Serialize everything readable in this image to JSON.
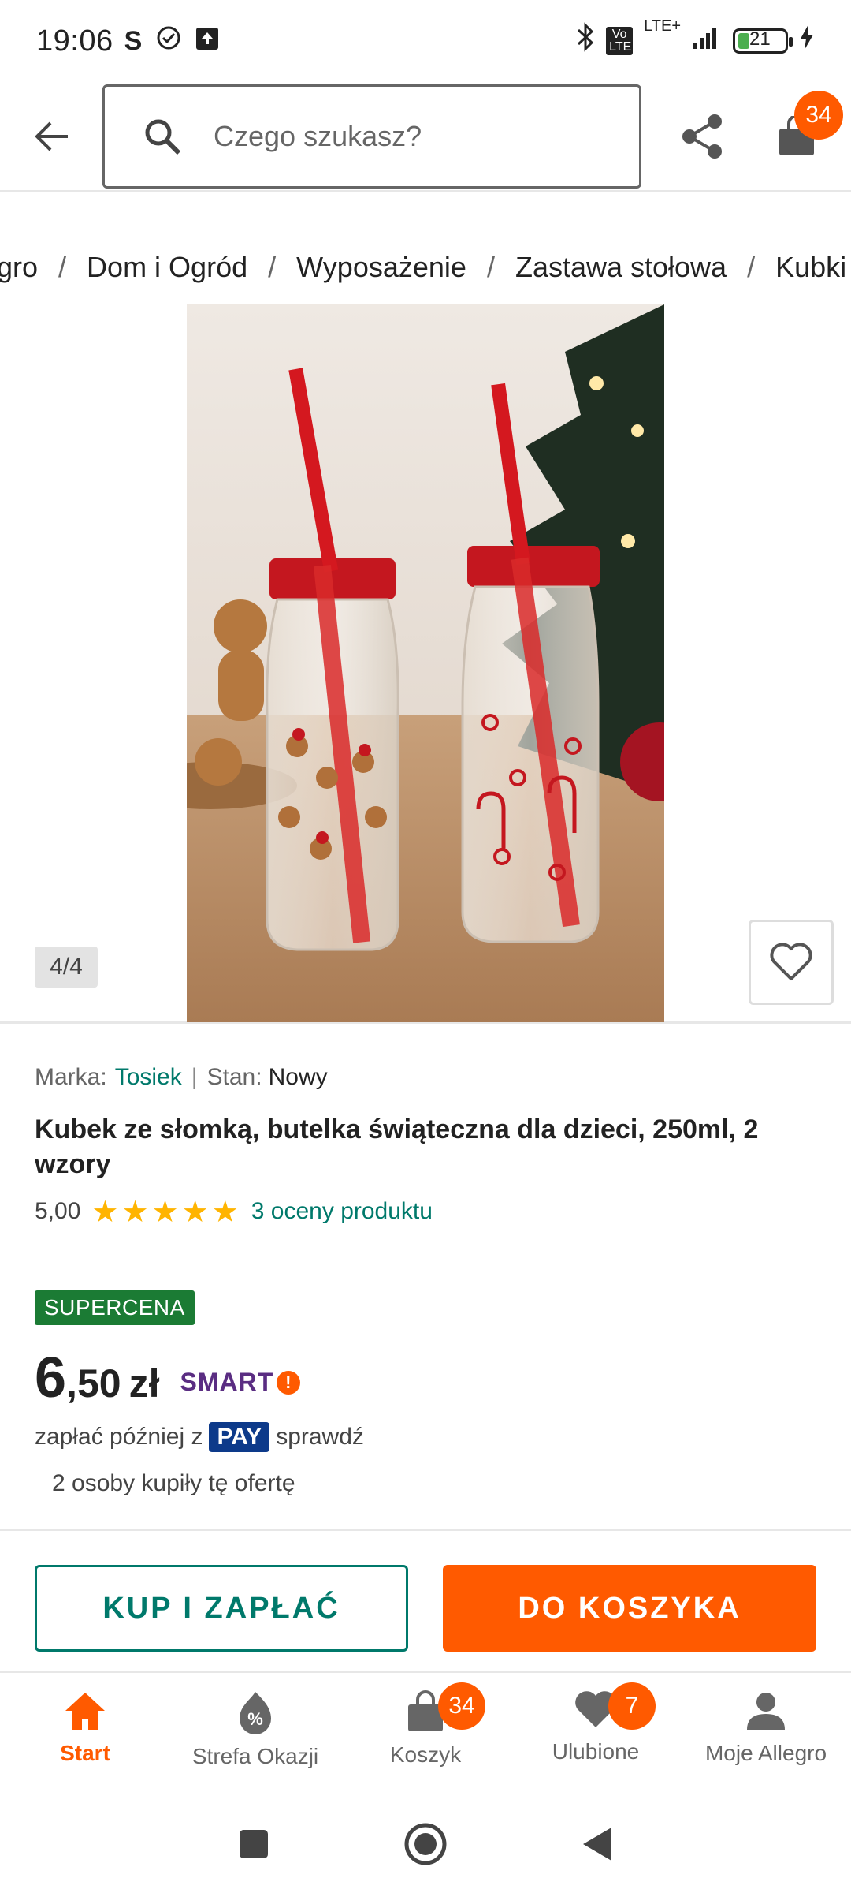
{
  "status_bar": {
    "time": "19:06",
    "s_indicator": "S",
    "network": "LTE+",
    "volte": "Vo LTE",
    "battery": "21"
  },
  "header": {
    "search_placeholder": "Czego szukasz?",
    "cart_count": "34"
  },
  "breadcrumb": [
    "gro",
    "Dom i Ogród",
    "Wyposażenie",
    "Zastawa stołowa",
    "Kubki"
  ],
  "gallery": {
    "counter": "4/4"
  },
  "product": {
    "brand_label": "Marka:",
    "brand": "Tosiek",
    "separator": "|",
    "condition_label": "Stan:",
    "condition": "Nowy",
    "title": "Kubek ze słomką, butelka świąteczna dla dzieci, 250ml, 2 wzory",
    "rating": "5,00",
    "rating_fraction": 1.0,
    "reviews": "3 oceny produktu",
    "badge": "SUPERCENA",
    "price_int": "6",
    "price_frac": ",50",
    "currency": "zł",
    "smart_label": "SMART",
    "pay_prefix": "zapłać później z",
    "pay_label": "PAY",
    "pay_suffix": "sprawdź",
    "buyers": "2 osoby kupiły tę ofertę"
  },
  "actions": {
    "buy_now": "KUP I ZAPŁAĆ",
    "add_to_cart": "DO KOSZYKA"
  },
  "bottom_nav": [
    {
      "label": "Start",
      "icon": "home-icon",
      "active": true
    },
    {
      "label": "Strefa Okazji",
      "icon": "deals-icon"
    },
    {
      "label": "Koszyk",
      "icon": "bag-icon",
      "badge": "34"
    },
    {
      "label": "Ulubione",
      "icon": "heart-icon",
      "badge": "7"
    },
    {
      "label": "Moje Allegro",
      "icon": "person-icon"
    }
  ],
  "colors": {
    "accent": "#ff5a00",
    "teal": "#00796b",
    "supercena": "#1b7b34",
    "pay": "#0d3a8a"
  }
}
